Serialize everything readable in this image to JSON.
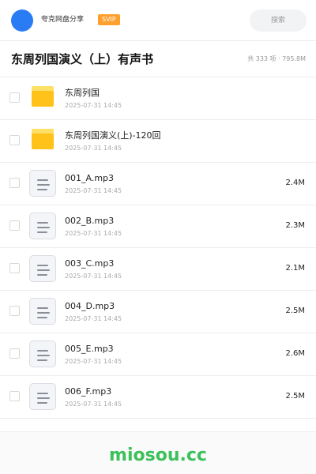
{
  "header": {
    "site_name": "夸克网盘分享",
    "badge": "SVIP",
    "search_placeholder": "搜索",
    "avatar_color": "#2a7cf5",
    "badge_color": "#ff9f2e"
  },
  "folder": {
    "title": "东周列国演义（上）有声书",
    "summary": "共 333 项 · 795.8M"
  },
  "files": [
    {
      "type": "folder",
      "name": "东周列国",
      "date": "2025-07-31 14:45",
      "size": ""
    },
    {
      "type": "folder",
      "name": "东周列国演义(上)-120回",
      "date": "2025-07-31 14:45",
      "size": ""
    },
    {
      "type": "file",
      "name": "001_A.mp3",
      "date": "2025-07-31 14:45",
      "size": "2.4M"
    },
    {
      "type": "file",
      "name": "002_B.mp3",
      "date": "2025-07-31 14:45",
      "size": "2.3M"
    },
    {
      "type": "file",
      "name": "003_C.mp3",
      "date": "2025-07-31 14:45",
      "size": "2.1M"
    },
    {
      "type": "file",
      "name": "004_D.mp3",
      "date": "2025-07-31 14:45",
      "size": "2.5M"
    },
    {
      "type": "file",
      "name": "005_E.mp3",
      "date": "2025-07-31 14:45",
      "size": "2.6M"
    },
    {
      "type": "file",
      "name": "006_F.mp3",
      "date": "2025-07-31 14:45",
      "size": "2.5M"
    }
  ],
  "footer": {
    "watermark": "miosou.cc",
    "watermark_color": "#3cc05a"
  }
}
